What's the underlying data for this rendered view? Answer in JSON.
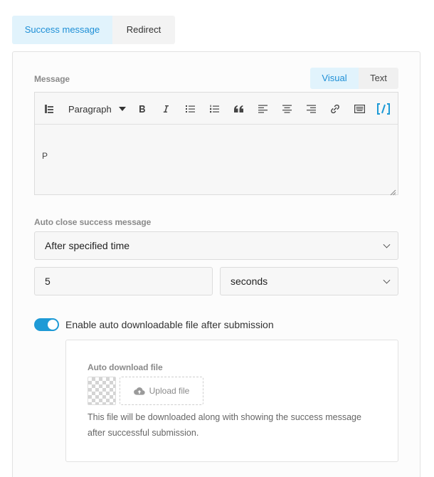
{
  "tabs": [
    {
      "label": "Success message",
      "active": true
    },
    {
      "label": "Redirect",
      "active": false
    }
  ],
  "message": {
    "label": "Message",
    "mode_visual": "Visual",
    "mode_text": "Text",
    "format_select": "Paragraph",
    "content": "",
    "path": "P",
    "toolbar_icons": [
      "toolbar-toggle-icon",
      "bold-icon",
      "italic-icon",
      "bullet-list-icon",
      "numbered-list-icon",
      "blockquote-icon",
      "align-left-icon",
      "align-center-icon",
      "align-right-icon",
      "link-icon",
      "keyboard-icon",
      "shortcode-icon"
    ]
  },
  "auto_close": {
    "label": "Auto close success message",
    "value": "After specified time",
    "amount": "5",
    "unit": "seconds"
  },
  "auto_download": {
    "enabled": true,
    "toggle_label": "Enable auto downloadable file after submission",
    "file_label": "Auto download file",
    "upload_button": "Upload file",
    "help_text": "This file will be downloaded along with showing the success message after successful submission."
  },
  "colors": {
    "accent": "#1e9ad6",
    "accent_bg": "#e1f3fc"
  }
}
